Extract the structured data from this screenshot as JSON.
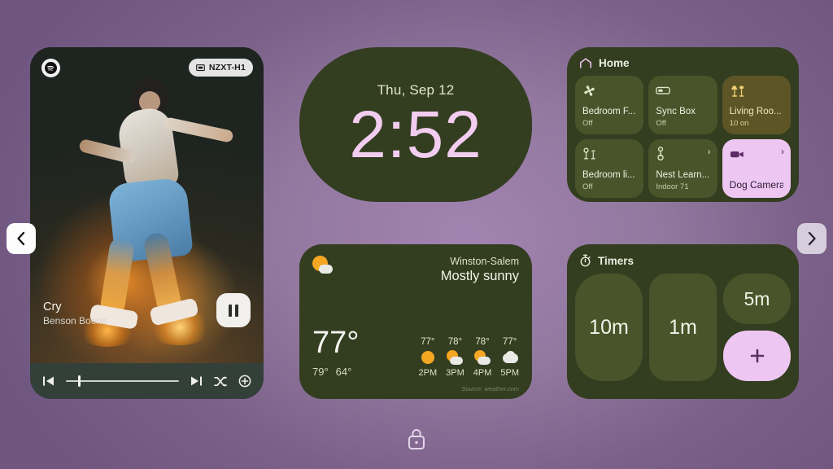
{
  "background": {
    "color_center": "#a183b0",
    "color_edge": "#6f5680"
  },
  "nav": {
    "prev_label": "‹",
    "next_label": "›",
    "prev_name": "previous-page",
    "next_name": "next-page"
  },
  "lock": {
    "name": "lock-icon"
  },
  "player": {
    "app_icon": "spotify-icon",
    "cast_device": "NZXT-H1",
    "cast_icon": "cast-screen-icon",
    "track_title": "Cry",
    "track_artist": "Benson Boone",
    "play_state": "playing",
    "pause_button_label": "Pause",
    "progress_percent": 11,
    "controls": [
      {
        "name": "previous-track-button",
        "glyph": "prev"
      },
      {
        "name": "next-track-button",
        "glyph": "next"
      },
      {
        "name": "shuffle-button",
        "glyph": "shuffle"
      },
      {
        "name": "add-to-library-button",
        "glyph": "plus-circle"
      }
    ]
  },
  "clock": {
    "date": "Thu, Sep 12",
    "time": "2:52",
    "time_color": "#f2cdf0",
    "date_color": "#e3e6cc"
  },
  "home": {
    "title": "Home",
    "title_icon": "home-icon",
    "tiles": [
      {
        "name": "Bedroom F...",
        "status": "Off",
        "icon": "fan-icon",
        "state": "off",
        "chevron": false
      },
      {
        "name": "Sync Box",
        "status": "Off",
        "icon": "sync-box-icon",
        "state": "off",
        "chevron": false
      },
      {
        "name": "Living Roo...",
        "status": "10 on",
        "icon": "lamp-icon",
        "state": "amber",
        "chevron": false
      },
      {
        "name": "Bedroom li...",
        "status": "Off",
        "icon": "lights-icon",
        "state": "off",
        "chevron": false
      },
      {
        "name": "Nest Learn...",
        "status": "Indoor 71",
        "icon": "thermostat-icon",
        "state": "off",
        "chevron": true
      },
      {
        "name": "Dog Camera",
        "status": "",
        "icon": "camera-icon",
        "state": "active",
        "chevron": true
      }
    ]
  },
  "weather": {
    "city": "Winston-Salem",
    "condition": "Mostly sunny",
    "condition_icon": "sun-behind-cloud-icon",
    "current_temp": "77°",
    "high": "79°",
    "low": "64°",
    "source": "Source: weather.com",
    "hourly": [
      {
        "temp": "77°",
        "time": "2PM",
        "icon": "sunny-icon"
      },
      {
        "temp": "78°",
        "time": "3PM",
        "icon": "partly-cloudy-icon"
      },
      {
        "temp": "78°",
        "time": "4PM",
        "icon": "partly-cloudy-icon"
      },
      {
        "temp": "77°",
        "time": "5PM",
        "icon": "cloudy-icon"
      }
    ]
  },
  "timers": {
    "title": "Timers",
    "title_icon": "stopwatch-icon",
    "presets": [
      {
        "label": "10m"
      },
      {
        "label": "1m"
      },
      {
        "label": "5m"
      }
    ],
    "add_label": "+",
    "add_name": "add-timer-button"
  }
}
